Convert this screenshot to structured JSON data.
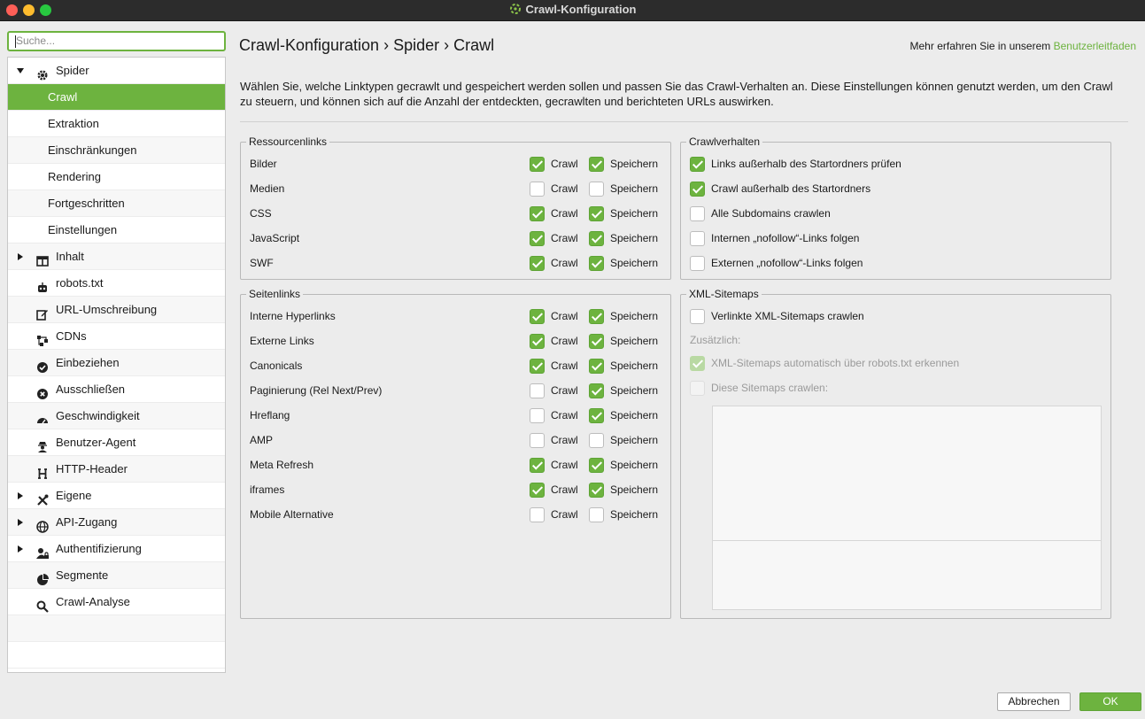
{
  "window": {
    "title": "Crawl-Konfiguration"
  },
  "search": {
    "placeholder": "Suche..."
  },
  "sidebar": {
    "items": [
      {
        "label": "Spider",
        "arrow": "down",
        "icon": "gear-icon",
        "level": 0
      },
      {
        "label": "Crawl",
        "level": 1,
        "selected": true
      },
      {
        "label": "Extraktion",
        "level": 1
      },
      {
        "label": "Einschränkungen",
        "level": 1
      },
      {
        "label": "Rendering",
        "level": 1
      },
      {
        "label": "Fortgeschritten",
        "level": 1
      },
      {
        "label": "Einstellungen",
        "level": 1
      },
      {
        "label": "Inhalt",
        "arrow": "right",
        "icon": "columns-icon",
        "level": 0
      },
      {
        "label": "robots.txt",
        "icon": "robot-icon",
        "level": 0
      },
      {
        "label": "URL-Umschreibung",
        "icon": "edit-icon",
        "level": 0
      },
      {
        "label": "CDNs",
        "icon": "network-icon",
        "level": 0
      },
      {
        "label": "Einbeziehen",
        "icon": "check-circle-icon",
        "level": 0
      },
      {
        "label": "Ausschließen",
        "icon": "x-circle-icon",
        "level": 0
      },
      {
        "label": "Geschwindigkeit",
        "icon": "gauge-icon",
        "level": 0
      },
      {
        "label": "Benutzer-Agent",
        "icon": "user-secret-icon",
        "level": 0
      },
      {
        "label": "HTTP-Header",
        "icon": "header-icon",
        "level": 0
      },
      {
        "label": "Eigene",
        "arrow": "right",
        "icon": "tools-icon",
        "level": 0
      },
      {
        "label": "API-Zugang",
        "arrow": "right",
        "icon": "globe-icon",
        "level": 0
      },
      {
        "label": "Authentifizierung",
        "arrow": "right",
        "icon": "user-lock-icon",
        "level": 0
      },
      {
        "label": "Segmente",
        "icon": "pie-icon",
        "level": 0
      },
      {
        "label": "Crawl-Analyse",
        "icon": "search-icon",
        "level": 0
      }
    ]
  },
  "header": {
    "breadcrumb": "Crawl-Konfiguration  ›  Spider  ›  Crawl",
    "learn_prefix": "Mehr erfahren Sie in unserem ",
    "learn_link": "Benutzerleitfaden"
  },
  "intro": "Wählen Sie, welche Linktypen gecrawlt und gespeichert werden sollen und passen Sie das Crawl-Verhalten an. Diese Einstellungen können genutzt werden, um den Crawl zu steuern, und können sich auf die Anzahl der entdeckten, gecrawlten und berichteten URLs auswirken.",
  "labels": {
    "crawl": "Crawl",
    "store": "Speichern"
  },
  "resource_links": {
    "title": "Ressourcenlinks",
    "rows": [
      {
        "label": "Bilder",
        "crawl": true,
        "store": true
      },
      {
        "label": "Medien",
        "crawl": false,
        "store": false
      },
      {
        "label": "CSS",
        "crawl": true,
        "store": true
      },
      {
        "label": "JavaScript",
        "crawl": true,
        "store": true
      },
      {
        "label": "SWF",
        "crawl": true,
        "store": true
      }
    ]
  },
  "page_links": {
    "title": "Seitenlinks",
    "rows": [
      {
        "label": "Interne Hyperlinks",
        "crawl": true,
        "store": true
      },
      {
        "label": "Externe Links",
        "crawl": true,
        "store": true
      },
      {
        "label": "Canonicals",
        "crawl": true,
        "store": true
      },
      {
        "label": "Paginierung (Rel Next/Prev)",
        "crawl": false,
        "store": true
      },
      {
        "label": "Hreflang",
        "crawl": false,
        "store": true
      },
      {
        "label": "AMP",
        "crawl": false,
        "store": false
      },
      {
        "label": "Meta Refresh",
        "crawl": true,
        "store": true
      },
      {
        "label": "iframes",
        "crawl": true,
        "store": true
      },
      {
        "label": "Mobile Alternative",
        "crawl": false,
        "store": false
      }
    ]
  },
  "crawl_behavior": {
    "title": "Crawlverhalten",
    "rows": [
      {
        "label": "Links außerhalb des Startordners prüfen",
        "checked": true
      },
      {
        "label": "Crawl außerhalb des Startordners",
        "checked": true
      },
      {
        "label": "Alle Subdomains crawlen",
        "checked": false
      },
      {
        "label": "Internen „nofollow“-Links folgen",
        "checked": false
      },
      {
        "label": "Externen „nofollow“-Links folgen",
        "checked": false
      }
    ]
  },
  "sitemaps": {
    "title": "XML-Sitemaps",
    "crawl_linked": {
      "label": "Verlinkte XML-Sitemaps crawlen",
      "checked": false
    },
    "additional_label": "Zusätzlich:",
    "auto_detect": {
      "label": "XML-Sitemaps automatisch über robots.txt erkennen",
      "checked": true,
      "disabled": true
    },
    "crawl_these": {
      "label": "Diese Sitemaps crawlen:",
      "checked": false,
      "disabled": true
    }
  },
  "footer": {
    "cancel": "Abbrechen",
    "ok": "OK"
  },
  "colors": {
    "accent": "#6db33f",
    "titlebar": "#2c2c2c"
  }
}
